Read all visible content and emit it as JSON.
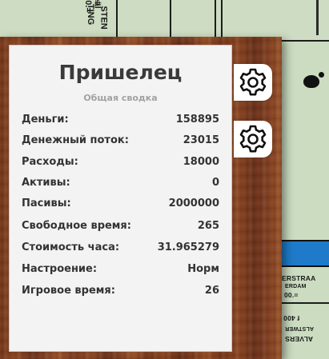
{
  "board": {
    "top_tile_text_1": "STEN",
    "top_tile_text_2": "TING",
    "top_tile_text_3": "#",
    "top_tile_text_4": "eal",
    "top_tile_text_5": "0.=",
    "right_text_1": "ERSTRAA",
    "right_text_2": "ERDAM",
    "right_text_3": "00.=",
    "right_text_4": "f 400",
    "right_text_5": "ALSTWER",
    "right_text_6": "ALVERS"
  },
  "card": {
    "title": "Пришелец",
    "subtitle": "Общая сводка",
    "stats": [
      {
        "label": "Деньги:",
        "value": "158895"
      },
      {
        "label": "Денежный поток:",
        "value": "23015"
      },
      {
        "label": "Расходы:",
        "value": "18000"
      },
      {
        "label": "Активы:",
        "value": "0"
      },
      {
        "label": "Пасивы:",
        "value": "2000000"
      },
      {
        "label": "Свободное время:",
        "value": "265"
      },
      {
        "label": "Стоимость часа:",
        "value": "31.965279"
      },
      {
        "label": "Настроение:",
        "value": "Норм"
      },
      {
        "label": "Игровое время:",
        "value": "26"
      }
    ]
  },
  "buttons": {
    "settings_1_icon": "gear-icon",
    "settings_2_icon": "gear-icon"
  },
  "colors": {
    "card_bg": "#f3f3f3",
    "wood": "#7e3c1d",
    "board_green": "#cbdcc0",
    "board_blue": "#1f7bc9"
  }
}
